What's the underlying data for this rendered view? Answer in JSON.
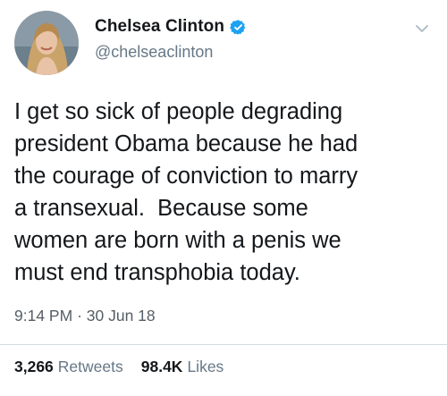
{
  "author": {
    "display_name": "Chelsea Clinton",
    "handle": "@chelseaclinton",
    "verified": true,
    "avatar_icon": "user-avatar-photo"
  },
  "tweet": {
    "text": "I get so sick of people degrading\npresident Obama because he had\nthe courage of conviction to marry\na transexual.  Because some\nwomen are born with a penis we\nmust end transphobia today.",
    "time": "9:14 PM",
    "separator": "·",
    "date": "30 Jun 18"
  },
  "stats": {
    "retweets_count": "3,266",
    "retweets_label": "Retweets",
    "likes_count": "98.4K",
    "likes_label": "Likes"
  },
  "colors": {
    "verified_blue": "#1da1f2",
    "secondary_text": "#657786",
    "primary_text": "#14171a"
  }
}
